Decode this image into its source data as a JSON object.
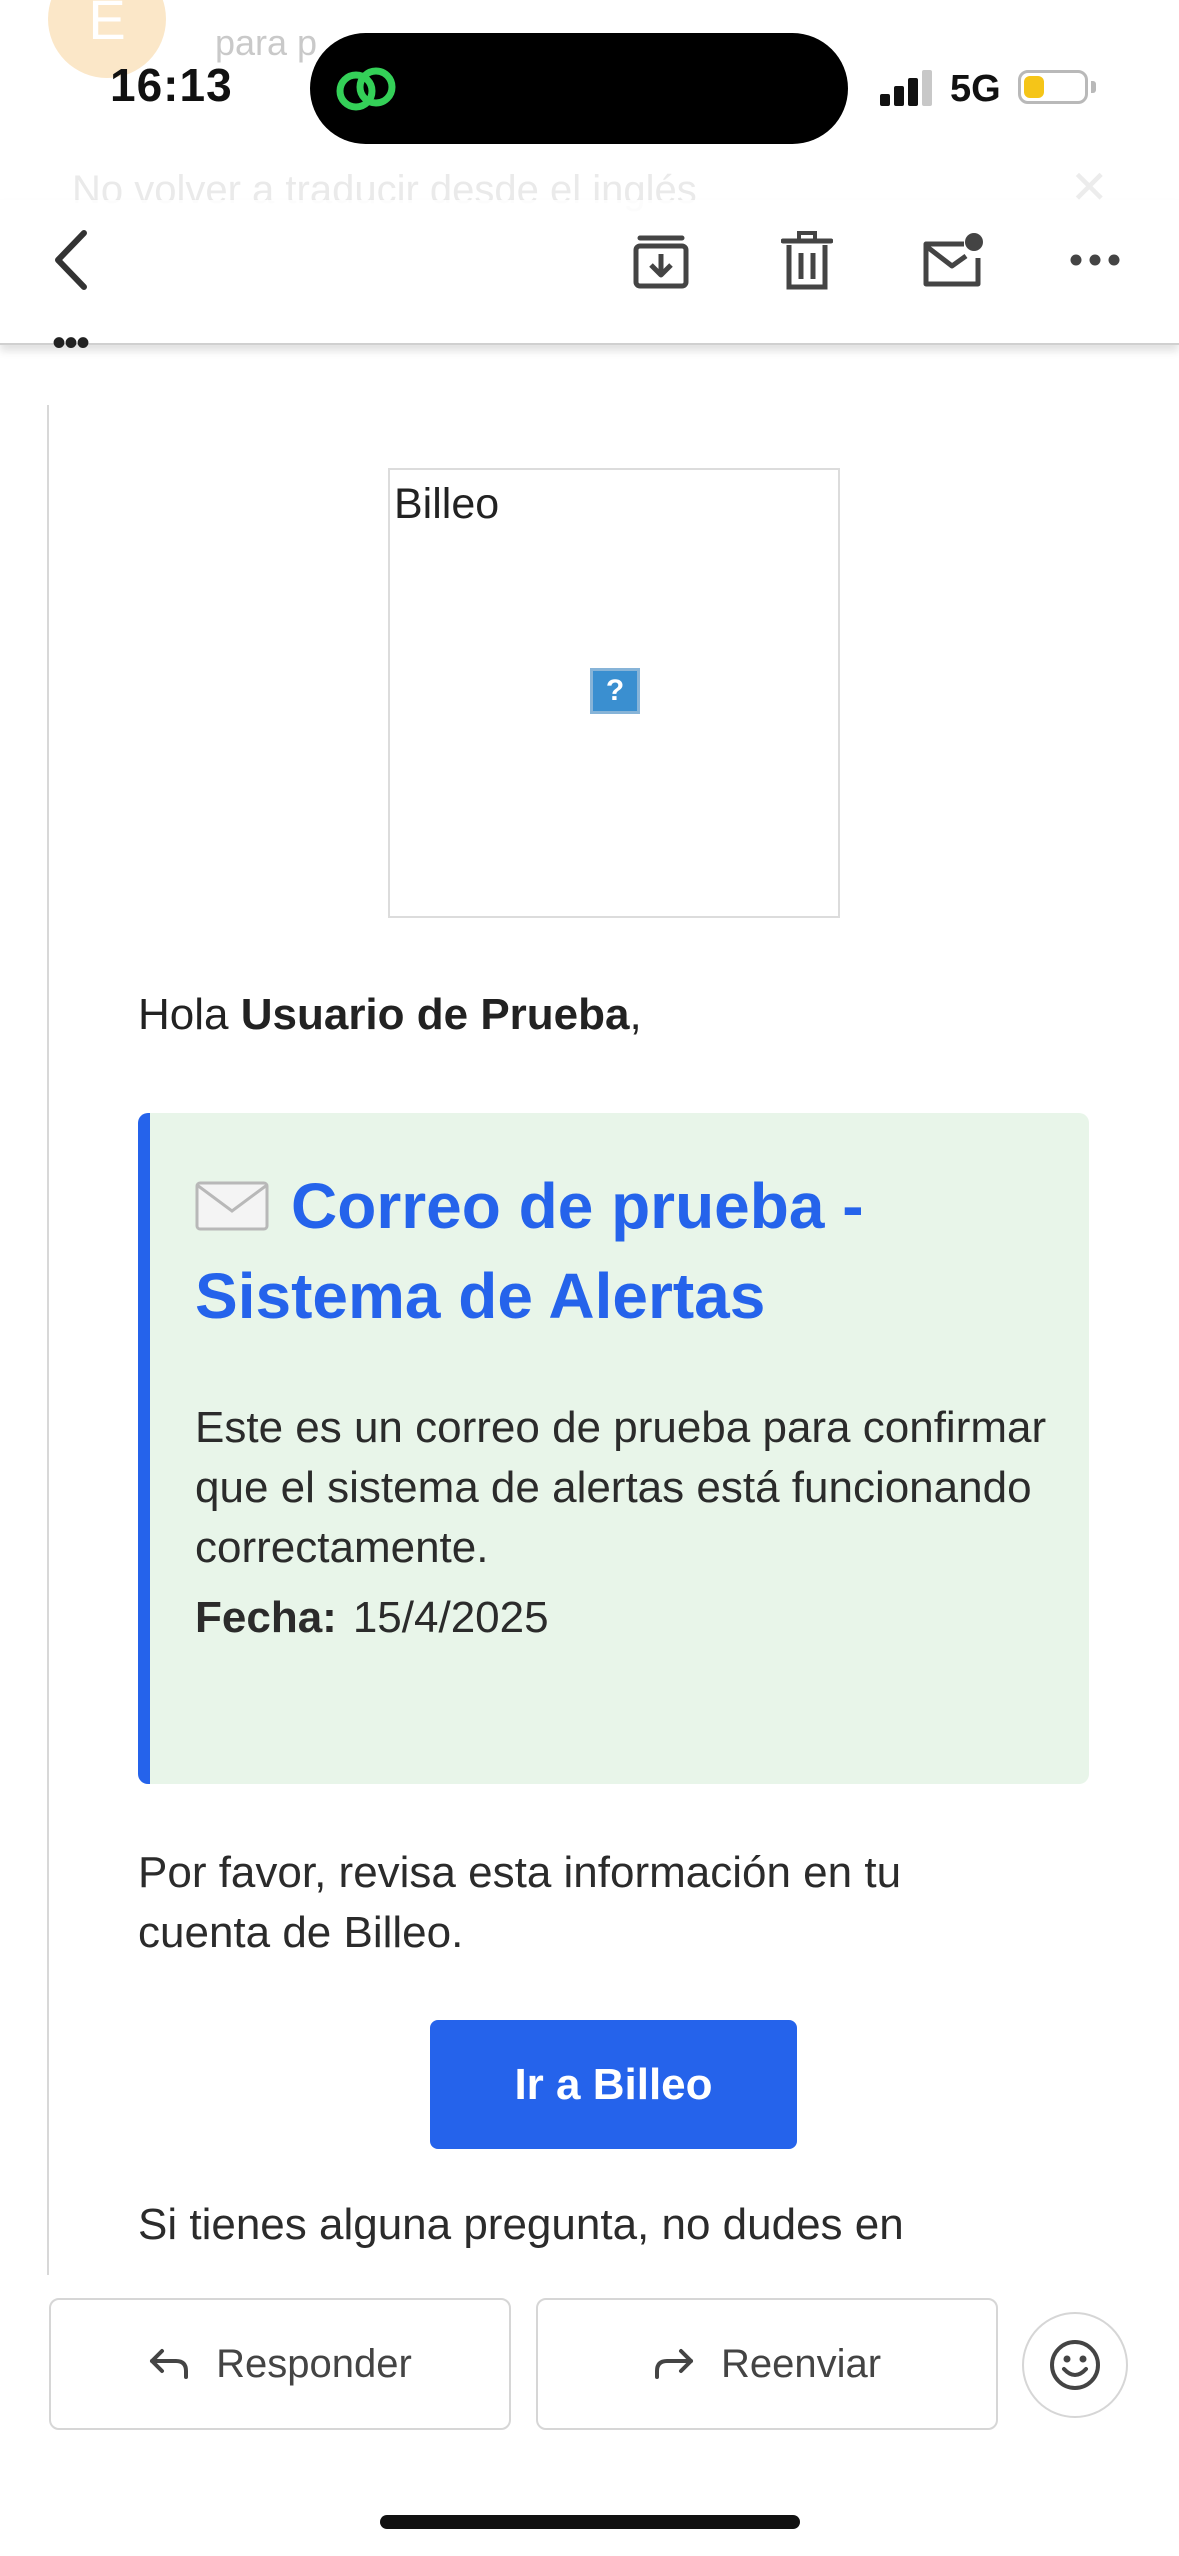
{
  "background": {
    "avatar_initial": "E",
    "recipient_prefix": "para p",
    "translate_banner": "No volver a traducir desde el inglés"
  },
  "status_bar": {
    "time": "16:13",
    "network": "5G",
    "battery_level": 0.35,
    "icons": [
      "link-icon",
      "signal-icon",
      "battery-icon"
    ]
  },
  "toolbar": {
    "icons": [
      "back-icon",
      "archive-icon",
      "trash-icon",
      "mark-unread-icon",
      "more-icon"
    ],
    "collapsed_indicator": "•••"
  },
  "email": {
    "logo_alt": "Billeo",
    "logo_broken_glyph": "?",
    "greeting_prefix": "Hola ",
    "greeting_name": "Usuario de Prueba",
    "greeting_suffix": ",",
    "alert": {
      "title": "Correo de prueba - Sistema de Alertas",
      "body": "Este es un correo de prueba para confirmar que el sistema de alertas está funcionando correctamente.",
      "date_label": "Fecha:",
      "date_value": "15/4/2025",
      "accent_color": "#2563eb",
      "background_color": "#e8f5e9"
    },
    "review_text": "Por favor, revisa esta información en tu cuenta de Billeo.",
    "cta_label": "Ir a Billeo",
    "question_text": "Si tienes alguna pregunta, no dudes en"
  },
  "actions": {
    "reply_label": "Responder",
    "forward_label": "Reenviar",
    "icons": [
      "reply-icon",
      "forward-icon",
      "emoji-icon"
    ]
  }
}
